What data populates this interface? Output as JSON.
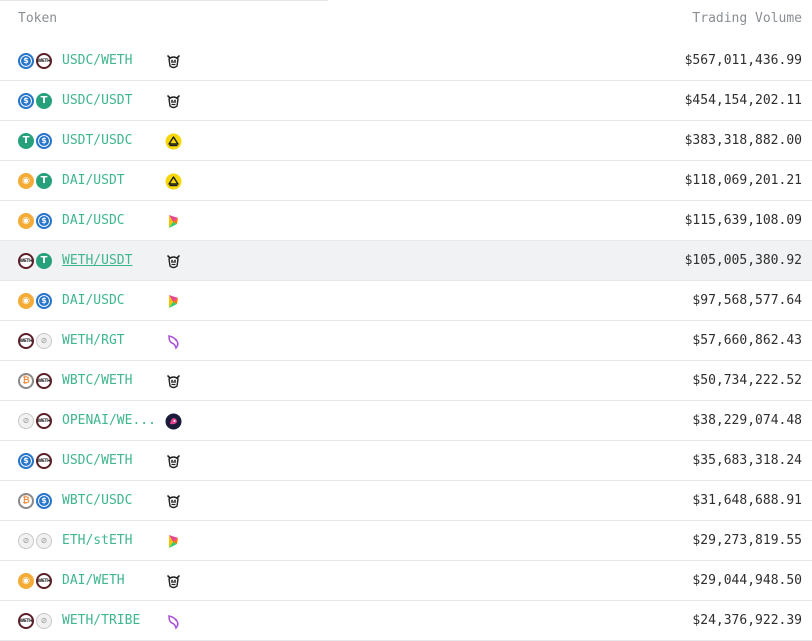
{
  "header": {
    "token_label": "Token",
    "volume_label": "Trading Volume"
  },
  "colors": {
    "pair_text": "#3fb68e",
    "hover_row": "#f1f2f3",
    "divider": "#e6e8ea",
    "header_text": "#8a8f95"
  },
  "rows": [
    {
      "pair": "USDC/WETH",
      "tokens": [
        "usdc",
        "weth"
      ],
      "venue": "sushiswap-icon",
      "volume": "$567,011,436.99"
    },
    {
      "pair": "USDC/USDT",
      "tokens": [
        "usdc",
        "usdt"
      ],
      "venue": "sushiswap-icon",
      "volume": "$454,154,202.11"
    },
    {
      "pair": "USDT/USDC",
      "tokens": [
        "usdt",
        "usdc"
      ],
      "venue": "curve-icon",
      "volume": "$383,318,882.00"
    },
    {
      "pair": "DAI/USDT",
      "tokens": [
        "dai",
        "usdt"
      ],
      "venue": "curve-icon",
      "volume": "$118,069,201.21"
    },
    {
      "pair": "DAI/USDC",
      "tokens": [
        "dai",
        "usdc"
      ],
      "venue": "balancer-icon",
      "volume": "$115,639,108.09"
    },
    {
      "pair": "WETH/USDT",
      "tokens": [
        "weth",
        "usdt"
      ],
      "venue": "sushiswap-icon",
      "volume": "$105,005,380.92",
      "hovered": true
    },
    {
      "pair": "DAI/USDC",
      "tokens": [
        "dai",
        "usdc"
      ],
      "venue": "balancer-icon",
      "volume": "$97,568,577.64"
    },
    {
      "pair": "WETH/RGT",
      "tokens": [
        "weth",
        "generic"
      ],
      "venue": "uniswap-icon",
      "volume": "$57,660,862.43"
    },
    {
      "pair": "WBTC/WETH",
      "tokens": [
        "wbtc",
        "weth"
      ],
      "venue": "sushiswap-icon",
      "volume": "$50,734,222.52"
    },
    {
      "pair": "OPENAI/WE...",
      "tokens": [
        "generic",
        "weth"
      ],
      "venue": "shibaswap-icon",
      "volume": "$38,229,074.48"
    },
    {
      "pair": "USDC/WETH",
      "tokens": [
        "usdc",
        "weth"
      ],
      "venue": "sushiswap-icon",
      "volume": "$35,683,318.24"
    },
    {
      "pair": "WBTC/USDC",
      "tokens": [
        "wbtc",
        "usdc"
      ],
      "venue": "sushiswap-icon",
      "volume": "$31,648,688.91"
    },
    {
      "pair": "ETH/stETH",
      "tokens": [
        "generic",
        "generic"
      ],
      "venue": "balancer-icon",
      "volume": "$29,273,819.55"
    },
    {
      "pair": "DAI/WETH",
      "tokens": [
        "dai",
        "weth"
      ],
      "venue": "sushiswap-icon",
      "volume": "$29,044,948.50"
    },
    {
      "pair": "WETH/TRIBE",
      "tokens": [
        "weth",
        "generic"
      ],
      "venue": "uniswap-icon",
      "volume": "$24,376,922.39"
    }
  ]
}
